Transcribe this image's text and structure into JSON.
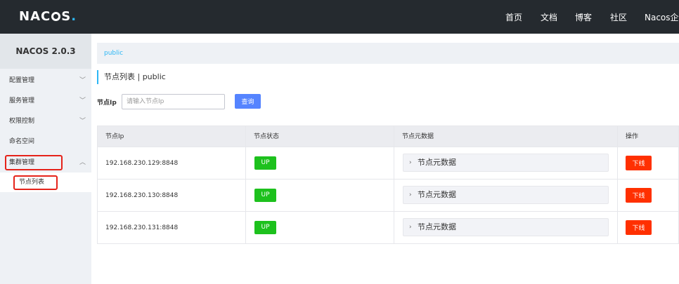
{
  "header": {
    "logo_text": "NACOS.",
    "nav": [
      "首页",
      "文档",
      "博客",
      "社区",
      "Nacos企业"
    ]
  },
  "sidebar": {
    "version": "NACOS 2.0.3",
    "items": [
      {
        "label": "配置管理",
        "chevron": "down"
      },
      {
        "label": "服务管理",
        "chevron": "down"
      },
      {
        "label": "权限控制",
        "chevron": "down"
      },
      {
        "label": "命名空间",
        "chevron": ""
      },
      {
        "label": "集群管理",
        "chevron": "up",
        "highlighted": true
      }
    ],
    "subitem": {
      "label": "节点列表",
      "highlighted": true
    }
  },
  "breadcrumb": "public",
  "page_title": "节点列表  |  public",
  "filter": {
    "label": "节点Ip",
    "placeholder": "请输入节点Ip",
    "query_button": "查询"
  },
  "table": {
    "columns": [
      "节点Ip",
      "节点状态",
      "节点元数据",
      "操作"
    ],
    "rows": [
      {
        "ip": "192.168.230.129:8848",
        "status": "UP",
        "metadata": "节点元数据",
        "action": "下线"
      },
      {
        "ip": "192.168.230.130:8848",
        "status": "UP",
        "metadata": "节点元数据",
        "action": "下线"
      },
      {
        "ip": "192.168.230.131:8848",
        "status": "UP",
        "metadata": "节点元数据",
        "action": "下线"
      }
    ]
  },
  "colors": {
    "topbar": "#252a2f",
    "accent": "#2db7f5",
    "primary_button": "#5584ff",
    "status_up": "#1dc11d",
    "danger_button": "#ff3000",
    "highlight_border": "#e5231a"
  }
}
